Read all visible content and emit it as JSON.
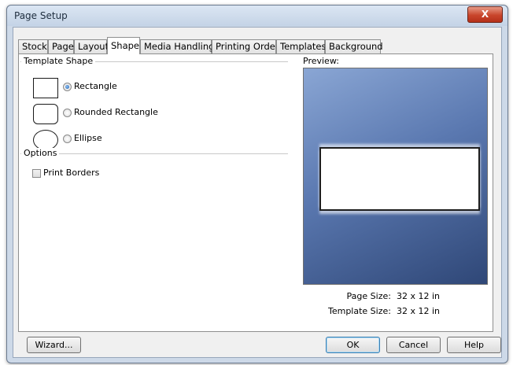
{
  "window": {
    "title": "Page Setup",
    "close_glyph": "X"
  },
  "tabs": [
    {
      "label": "Stock"
    },
    {
      "label": "Page"
    },
    {
      "label": "Layout"
    },
    {
      "label": "Shape",
      "active": true
    },
    {
      "label": "Media Handling"
    },
    {
      "label": "Printing Order"
    },
    {
      "label": "Templates"
    },
    {
      "label": "Background"
    }
  ],
  "template_shape": {
    "heading": "Template Shape",
    "options": [
      {
        "label": "Rectangle",
        "selected": true
      },
      {
        "label": "Rounded Rectangle",
        "selected": false
      },
      {
        "label": "Ellipse",
        "selected": false
      }
    ]
  },
  "options": {
    "heading": "Options",
    "print_borders": {
      "label": "Print Borders",
      "checked": false
    }
  },
  "preview": {
    "heading": "Preview:",
    "page_size_label": "Page Size:",
    "page_size_value": "32 x 12 in",
    "template_size_label": "Template Size:",
    "template_size_value": "32 x 12 in"
  },
  "buttons": {
    "wizard": "Wizard...",
    "ok": "OK",
    "cancel": "Cancel",
    "help": "Help"
  },
  "colors": {
    "preview_gradient_light": "#8aa6d4",
    "preview_gradient_dark": "#2f4777",
    "close_button": "#c8452b"
  }
}
